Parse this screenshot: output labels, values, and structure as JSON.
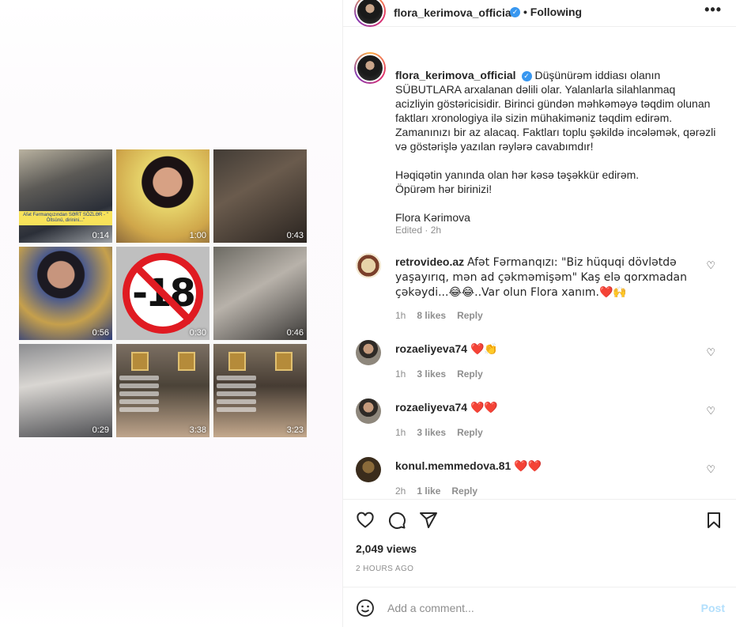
{
  "post_media": {
    "tiles": [
      {
        "duration": "0:14",
        "overlay": "Afət Fərmanqızından SƏRT SÖZLƏR - \" Öltsünü, dirinini...\""
      },
      {
        "duration": "1:00"
      },
      {
        "duration": "0:43"
      },
      {
        "duration": "0:56"
      },
      {
        "duration": "0:30",
        "sign": "-18"
      },
      {
        "duration": "0:46"
      },
      {
        "duration": "0:29"
      },
      {
        "duration": "3:38"
      },
      {
        "duration": "3:23"
      }
    ]
  },
  "header": {
    "username": "flora_kerimova_official",
    "follow_status": "• Following",
    "more": "•••"
  },
  "caption": {
    "username": "flora_kerimova_official",
    "text": "Düşünürəm iddiası olanın SÜBUTLARA arxalanan dəlili olar. Yalanlarla silahlanmaq acizliyin göstəricisidir. Birinci gündən məhkəməyə təqdim olunan faktları xronologiya ilə sizin mühakiməniz təqdim edirəm. Zamanınızı bir az alacaq. Faktları toplu şəkildə incələmək, qərəzli və göstərişlə yazılan rəylərə cavabımdır!\n\nHəqiqətin yanında olan hər kəsə təşəkkür edirəm.\nÖpürəm hər birinizi!\n\nFlora Kərimova",
    "edited": "Edited · 2h"
  },
  "comments": [
    {
      "username": "retrovideo.az",
      "text": "Afət Fərmanqızı: \"Biz hüquqi dövlətdə yaşayırıq, mən ad çəkməmişəm\" Kaş elə qorxmadan çəkəydi...😂😂..Var olun Flora xanım.❤️🙌",
      "time": "1h",
      "likes": "8 likes",
      "reply": "Reply"
    },
    {
      "username": "rozaeliyeva74",
      "text": "❤️👏",
      "time": "1h",
      "likes": "3 likes",
      "reply": "Reply"
    },
    {
      "username": "rozaeliyeva74",
      "text": "❤️❤️",
      "time": "1h",
      "likes": "3 likes",
      "reply": "Reply"
    },
    {
      "username": "konul.memmedova.81",
      "text": "❤️❤️",
      "time": "2h",
      "likes": "1 like",
      "reply": "Reply"
    }
  ],
  "stats": {
    "views": "2,049 views",
    "posted_ago": "2 HOURS AGO"
  },
  "add_comment": {
    "placeholder": "Add a comment...",
    "post_label": "Post"
  },
  "icons": [
    "heart-icon",
    "comment-icon",
    "share-icon",
    "bookmark-icon",
    "emoji-icon",
    "verified-icon",
    "more-icon"
  ],
  "colors": {
    "verified": "#3897f0",
    "post_disabled": "#b2dffc",
    "meta_gray": "#8e8e8e"
  }
}
